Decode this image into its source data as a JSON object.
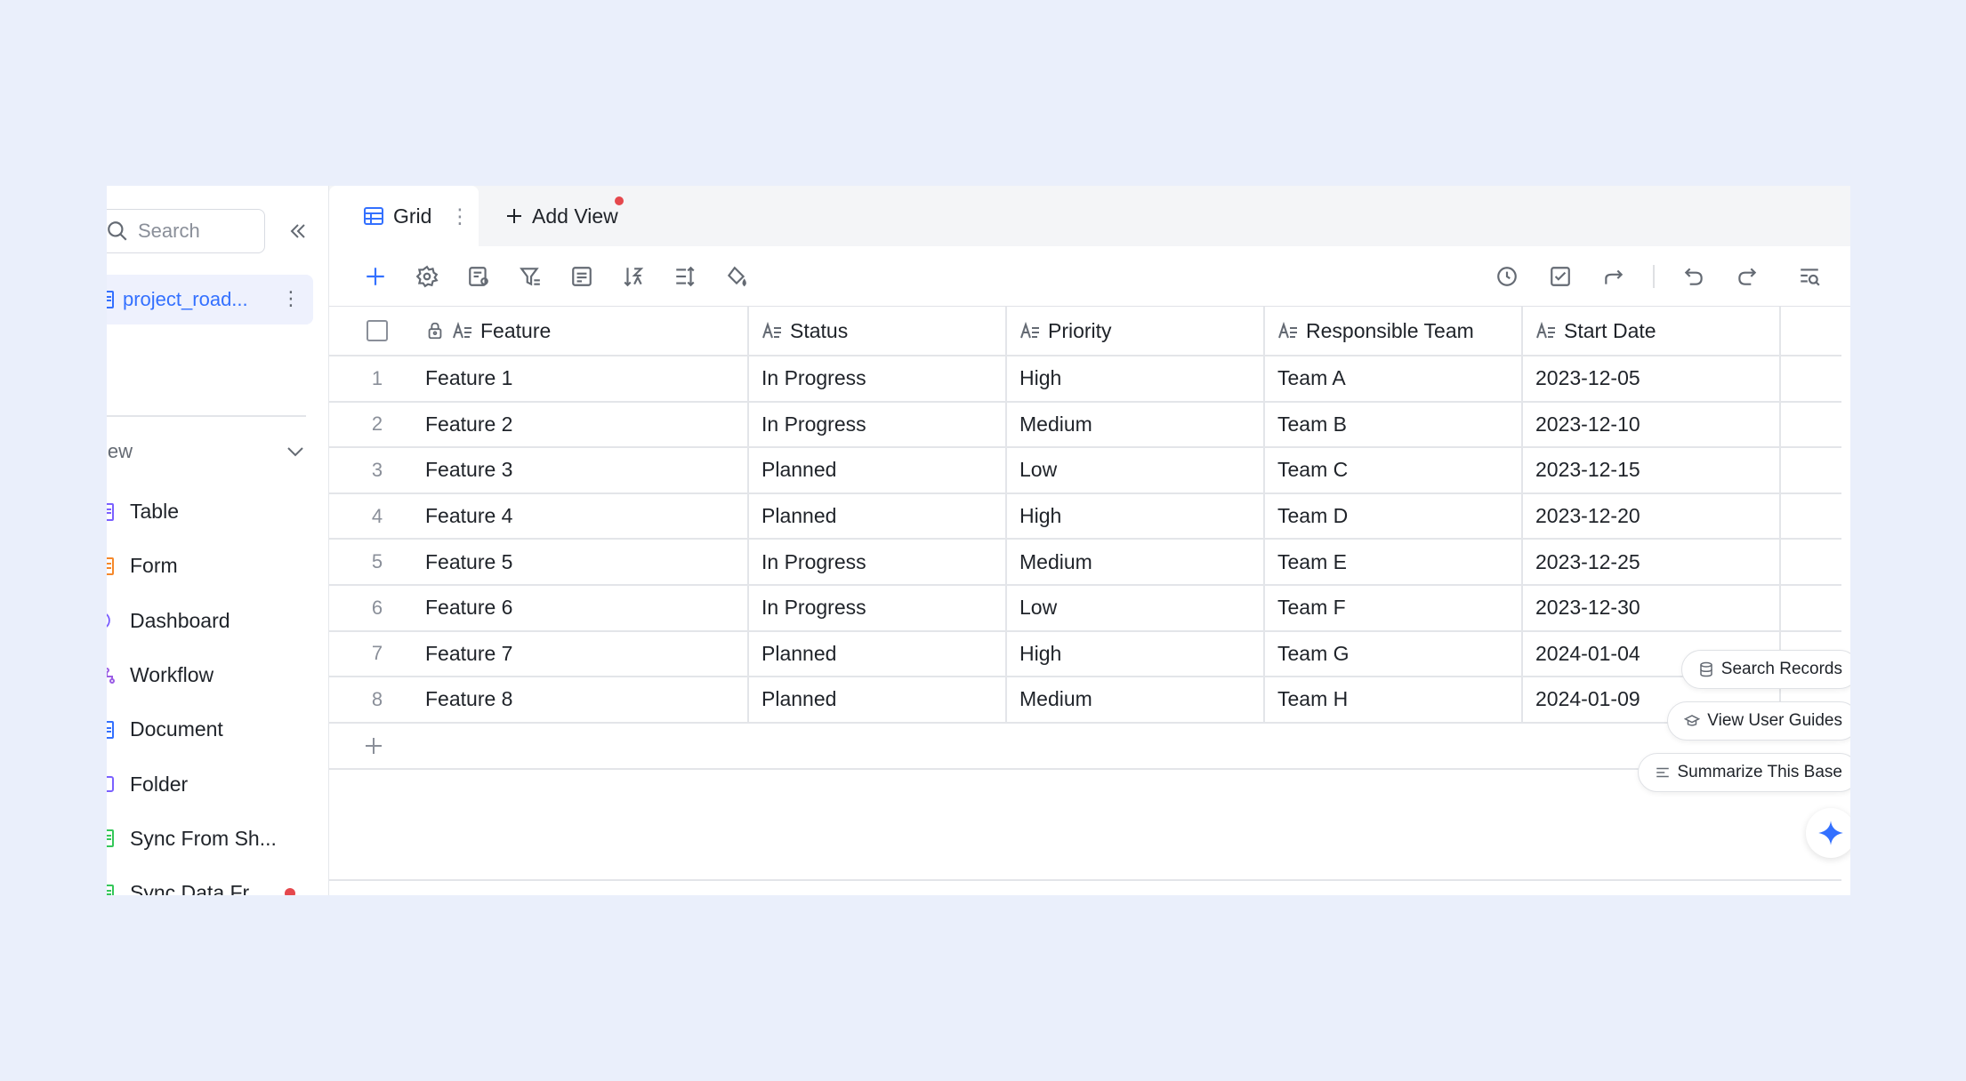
{
  "sidebar": {
    "search_placeholder": "Search",
    "file_name": "project_road...",
    "section_label": "iew",
    "items": [
      {
        "label": "Table",
        "color": "#7b61ff"
      },
      {
        "label": "Form",
        "color": "#f5882a"
      },
      {
        "label": "Dashboard",
        "color": "#7b61ff"
      },
      {
        "label": "Workflow",
        "color": "#9b5de5"
      },
      {
        "label": "Document",
        "color": "#3370ff"
      },
      {
        "label": "Folder",
        "color": "#7b61ff"
      },
      {
        "label": "Sync From Sh...",
        "color": "#34c759"
      },
      {
        "label": "Sync Data Fr...",
        "color": "#34c759"
      }
    ]
  },
  "tabs": {
    "grid_label": "Grid",
    "add_view_label": "Add View"
  },
  "table": {
    "columns": [
      "Feature",
      "Status",
      "Priority",
      "Responsible Team",
      "Start Date"
    ],
    "rows": [
      {
        "idx": "1",
        "feature": "Feature 1",
        "status": "In Progress",
        "priority": "High",
        "team": "Team A",
        "date": "2023-12-05"
      },
      {
        "idx": "2",
        "feature": "Feature 2",
        "status": "In Progress",
        "priority": "Medium",
        "team": "Team B",
        "date": "2023-12-10"
      },
      {
        "idx": "3",
        "feature": "Feature 3",
        "status": "Planned",
        "priority": "Low",
        "team": "Team C",
        "date": "2023-12-15"
      },
      {
        "idx": "4",
        "feature": "Feature 4",
        "status": "Planned",
        "priority": "High",
        "team": "Team D",
        "date": "2023-12-20"
      },
      {
        "idx": "5",
        "feature": "Feature 5",
        "status": "In Progress",
        "priority": "Medium",
        "team": "Team E",
        "date": "2023-12-25"
      },
      {
        "idx": "6",
        "feature": "Feature 6",
        "status": "In Progress",
        "priority": "Low",
        "team": "Team F",
        "date": "2023-12-30"
      },
      {
        "idx": "7",
        "feature": "Feature 7",
        "status": "Planned",
        "priority": "High",
        "team": "Team G",
        "date": "2024-01-04"
      },
      {
        "idx": "8",
        "feature": "Feature 8",
        "status": "Planned",
        "priority": "Medium",
        "team": "Team H",
        "date": "2024-01-09"
      }
    ]
  },
  "floating": {
    "search_records": "Search Records",
    "view_user_guides": "View User Guides",
    "summarize": "Summarize This Base"
  },
  "colors": {
    "accent": "#3370ff",
    "background": "#eaeffb",
    "notification": "#e5484d"
  }
}
